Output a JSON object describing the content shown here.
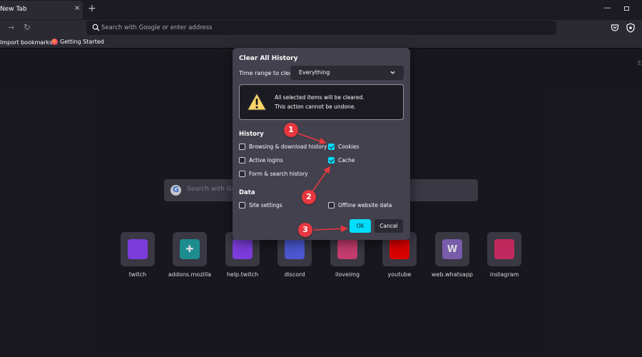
{
  "browser": {
    "tab": {
      "title": "New Tab",
      "close": "×"
    },
    "new_tab": "+",
    "window_controls": {
      "minimize": "—"
    },
    "nav": {
      "forward": "→",
      "reload": "↻"
    },
    "urlbar": {
      "placeholder": "Search with Google or enter address"
    },
    "bookmarks": {
      "import": "Import bookmarks...",
      "getting_started": "Getting Started"
    }
  },
  "newtab": {
    "side_marker": "E",
    "search": {
      "placeholder": "Search with Goo"
    },
    "tiles": [
      {
        "label": "twitch",
        "glyph": "",
        "color": "#9146ff",
        "icon": "twitch-icon"
      },
      {
        "label": "addons.mozilla",
        "glyph": "✚",
        "color": "#20a4a6",
        "icon": "puzzle-icon"
      },
      {
        "label": "help.twitch",
        "glyph": "",
        "color": "#9146ff",
        "icon": "twitch-icon"
      },
      {
        "label": "discord",
        "glyph": "",
        "color": "#5865f2",
        "icon": "discord-icon"
      },
      {
        "label": "iloveimg",
        "glyph": "",
        "color": "#e6467f",
        "icon": "iloveimg-icon"
      },
      {
        "label": "youtube",
        "glyph": "",
        "color": "#ff0000",
        "icon": "youtube-icon"
      },
      {
        "label": "web.whatsapp",
        "glyph": "W",
        "color": "#8e6cc7",
        "icon": "whatsapp-icon"
      },
      {
        "label": "instagram",
        "glyph": "",
        "color": "#e1306c",
        "icon": "instagram-icon"
      }
    ]
  },
  "dialog": {
    "title": "Clear All History",
    "range_label": "Time range to clear:",
    "range_value": "Everything",
    "warning": {
      "line1": "All selected items will be cleared.",
      "line2": "This action cannot be undone."
    },
    "history_heading": "History",
    "history_items": [
      {
        "label": "Browsing & download history",
        "checked": false
      },
      {
        "label": "Cookies",
        "checked": true
      },
      {
        "label": "Active logins",
        "checked": false
      },
      {
        "label": "Cache",
        "checked": true
      },
      {
        "label": "Form & search history",
        "checked": false
      }
    ],
    "data_heading": "Data",
    "data_items": [
      {
        "label": "Site settings",
        "checked": false
      },
      {
        "label": "Offline website data",
        "checked": false
      }
    ],
    "ok_label": "OK",
    "cancel_label": "Cancel"
  },
  "annotations": {
    "one": "1",
    "two": "2",
    "three": "3",
    "color": "#e8373f"
  },
  "colors": {
    "accent": "#00ddff",
    "dialog_bg": "#42414d",
    "page_bg": "#1c1b22"
  }
}
